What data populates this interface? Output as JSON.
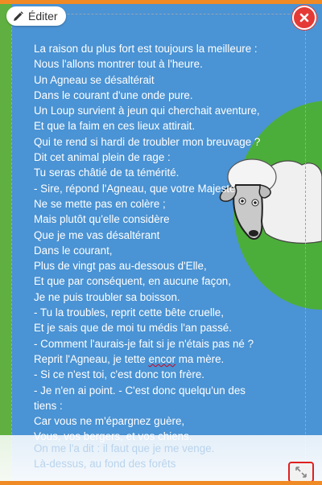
{
  "toolbar": {
    "edit_label": "Éditer"
  },
  "icons": {
    "edit": "pencil-icon",
    "close": "close-icon",
    "resize": "resize-icon"
  },
  "colors": {
    "accent": "#f08a24",
    "close": "#e53935",
    "background": "#4a93d4",
    "grass": "#4cae3a"
  },
  "poem": {
    "lines": [
      "La raison du plus fort est toujours la meilleure :",
      "Nous l'allons montrer tout à l'heure.",
      "Un Agneau se désaltérait",
      "Dans le courant d'une onde pure.",
      "Un Loup survient à jeun qui cherchait aventure,",
      "Et que la faim en ces lieux attirait.",
      "Qui te rend si hardi de troubler mon breuvage ?",
      "Dit cet animal plein de rage :",
      "Tu seras châtié de ta témérité.",
      "- Sire, répond l'Agneau, que votre Majesté",
      "Ne se mette pas en colère ;",
      "Mais plutôt qu'elle considère",
      "Que je me vas désaltérant",
      "Dans le courant,",
      "Plus de vingt pas au-dessous d'Elle,",
      "Et que par conséquent, en aucune façon,",
      "Je ne puis troubler sa boisson.",
      "- Tu la troubles, reprit cette bête cruelle,",
      "Et je sais que de moi tu médis l'an passé.",
      "- Comment l'aurais-je fait si je n'étais pas né ?",
      "Reprit l'Agneau, je tette encor ma mère.",
      "- Si ce n'est toi, c'est donc ton frère.",
      "- Je n'en ai point. - C'est donc quelqu'un des",
      "tiens :",
      "Car vous ne m'épargnez guère,",
      "Vous, vos bergers, et vos chiens."
    ],
    "faded_lines": [
      "On me l'a dit : il faut que je me venge.",
      "Là-dessus, au fond des forêts"
    ]
  }
}
